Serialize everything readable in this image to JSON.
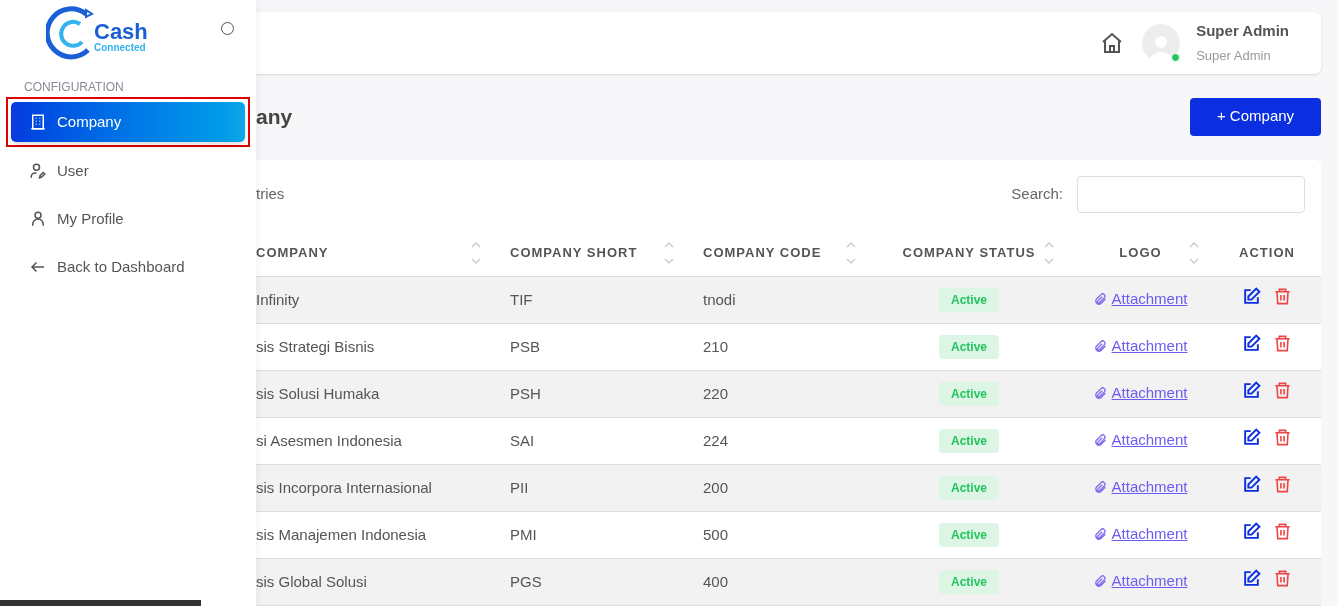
{
  "sidebar": {
    "logo": {
      "word": "Cash",
      "sub": "Connected"
    },
    "section": "CONFIGURATION",
    "items": [
      {
        "label": "Company",
        "kind": "building",
        "selected": true,
        "outlined": true
      },
      {
        "label": "User",
        "kind": "useredit",
        "selected": false,
        "outlined": false
      },
      {
        "label": "My Profile",
        "kind": "user",
        "selected": false,
        "outlined": false
      },
      {
        "label": "Back to Dashboard",
        "kind": "arrow",
        "selected": false,
        "outlined": false
      }
    ]
  },
  "header": {
    "user_name": "Super Admin",
    "user_role": "Super Admin",
    "online": true
  },
  "page_title": "any",
  "add_button": "+ Company",
  "entries_text": "tries",
  "search": {
    "label": "Search:"
  },
  "table": {
    "columns": [
      {
        "label": "COMPANY",
        "sortable": true
      },
      {
        "label": "COMPANY SHORT",
        "sortable": true
      },
      {
        "label": "COMPANY CODE",
        "sortable": true
      },
      {
        "label": "COMPANY STATUS",
        "sortable": true
      },
      {
        "label": "LOGO",
        "sortable": true
      },
      {
        "label": "ACTION",
        "sortable": false
      }
    ],
    "rows": [
      {
        "company": "Infinity",
        "short": "TIF",
        "code": "tnodi",
        "status": "Active",
        "logo": "Attachment"
      },
      {
        "company": "sis Strategi Bisnis",
        "short": "PSB",
        "code": "210",
        "status": "Active",
        "logo": "Attachment"
      },
      {
        "company": "sis Solusi Humaka",
        "short": "PSH",
        "code": "220",
        "status": "Active",
        "logo": "Attachment"
      },
      {
        "company": "si Asesmen Indonesia",
        "short": "SAI",
        "code": "224",
        "status": "Active",
        "logo": "Attachment"
      },
      {
        "company": "sis Incorpora Internasional",
        "short": "PII",
        "code": "200",
        "status": "Active",
        "logo": "Attachment"
      },
      {
        "company": "sis Manajemen Indonesia",
        "short": "PMI",
        "code": "500",
        "status": "Active",
        "logo": "Attachment"
      },
      {
        "company": "sis Global Solusi",
        "short": "PGS",
        "code": "400",
        "status": "Active",
        "logo": "Attachment"
      }
    ]
  }
}
